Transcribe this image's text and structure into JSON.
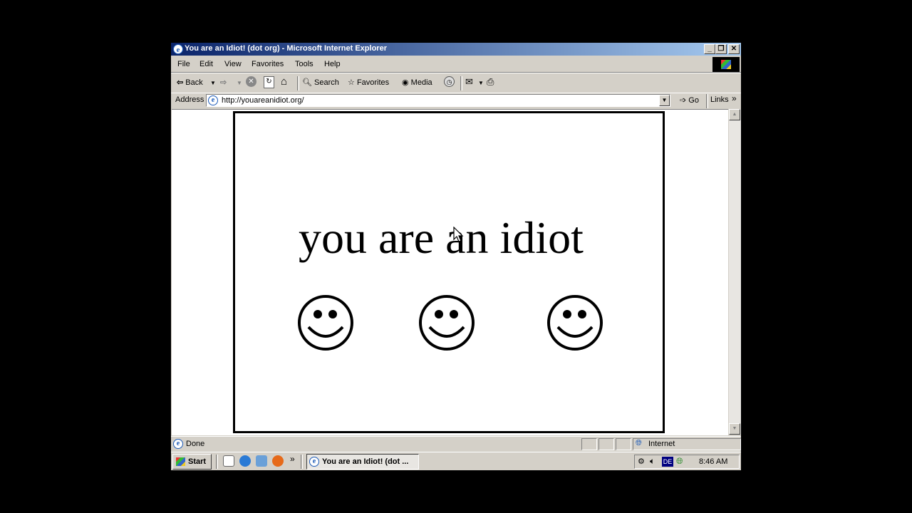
{
  "window": {
    "title": "You are an Idiot! (dot org) - Microsoft Internet Explorer",
    "controls": [
      "minimize",
      "restore",
      "close"
    ]
  },
  "menubar": {
    "items": [
      "File",
      "Edit",
      "View",
      "Favorites",
      "Tools",
      "Help"
    ]
  },
  "toolbar": {
    "back_label": "Back",
    "search_label": "Search",
    "favorites_label": "Favorites",
    "media_label": "Media"
  },
  "addressbar": {
    "label": "Address",
    "url": "http://youareanidiot.org/",
    "go_label": "Go",
    "links_label": "Links",
    "links_chevron": "»"
  },
  "page": {
    "headline": "you are an idiot",
    "smileys": [
      "smiley-face",
      "smiley-face",
      "smiley-face"
    ]
  },
  "statusbar": {
    "status_text": "Done",
    "zone_text": "Internet"
  },
  "taskbar": {
    "start_label": "Start",
    "quicklaunch_chevron": "»",
    "task_label": "You are an Idiot! (dot ...",
    "tray_lang": "DE",
    "clock": "8:46 AM"
  },
  "colors": {
    "titlebar_start": "#0a246a",
    "titlebar_end": "#a6caf0",
    "chrome": "#d4d0c8",
    "desktop": "#000000"
  }
}
